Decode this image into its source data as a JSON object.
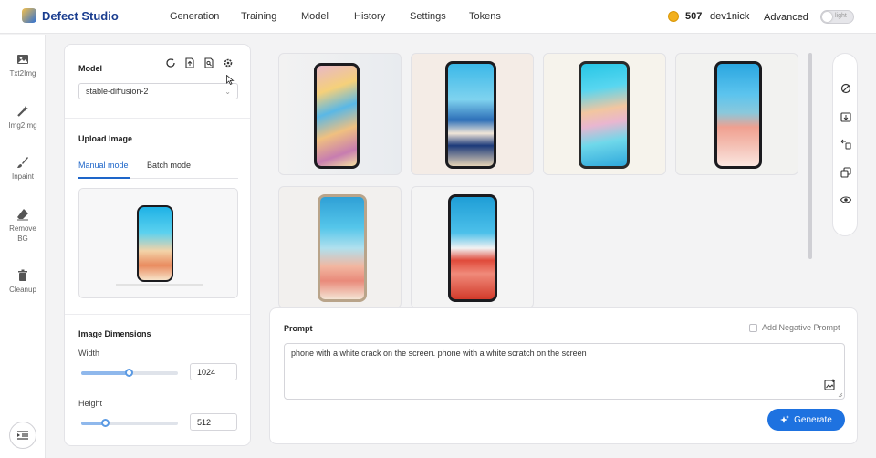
{
  "header": {
    "app_name": "Defect Studio",
    "nav": [
      "Generation",
      "Training",
      "Model",
      "History",
      "Settings",
      "Tokens"
    ],
    "token_count": "507",
    "username": "dev1nick",
    "advanced_label": "Advanced",
    "theme_toggle_label": "light",
    "coin_color": "#f2b01e"
  },
  "left_tools": [
    {
      "label": "Txt2Img",
      "icon": "image-icon"
    },
    {
      "label": "Img2Img",
      "icon": "magic-wand-icon"
    },
    {
      "label": "Inpaint",
      "icon": "brush-icon"
    },
    {
      "label": "Remove BG",
      "icon": "eraser-icon"
    },
    {
      "label": "Cleanup",
      "icon": "trash-icon"
    }
  ],
  "settings": {
    "model_title": "Model",
    "model_value": "stable-diffusion-2",
    "upload_title": "Upload Image",
    "tabs": [
      "Manual mode",
      "Batch mode"
    ],
    "active_tab": "Manual mode",
    "dimensions_title": "Image Dimensions",
    "width_label": "Width",
    "width_value": "1024",
    "width_fraction": 0.5,
    "height_label": "Height",
    "height_value": "512",
    "height_fraction": 0.25
  },
  "prompt": {
    "title": "Prompt",
    "negative_label": "Add Negative Prompt",
    "text": "phone with a white crack on the screen. phone with a white scratch on the screen",
    "generate_label": "Generate"
  },
  "colors": {
    "accent": "#1e72e0",
    "brand": "#1a3d8f"
  }
}
